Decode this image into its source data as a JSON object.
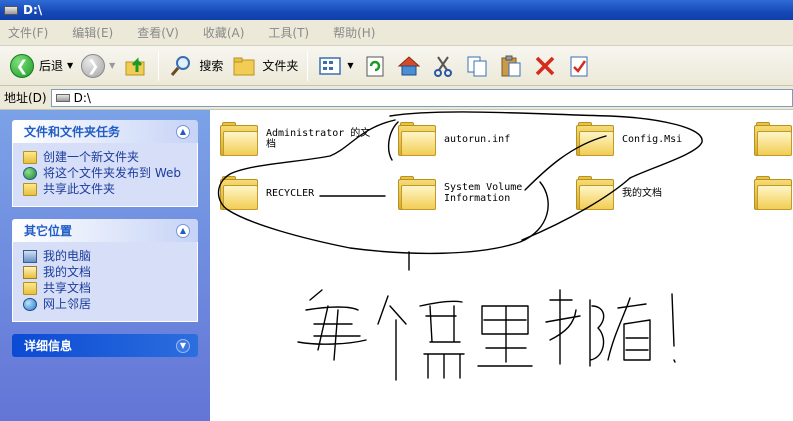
{
  "window": {
    "title": "D:\\"
  },
  "menu": [
    "文件(F)",
    "编辑(E)",
    "查看(V)",
    "收藏(A)",
    "工具(T)",
    "帮助(H)"
  ],
  "toolbar": {
    "back_label": "后退",
    "search_label": "搜索",
    "folders_label": "文件夹"
  },
  "address": {
    "label": "地址(D)",
    "value": "D:\\"
  },
  "task_panels": [
    {
      "title": "文件和文件夹任务",
      "items": [
        {
          "label": "创建一个新文件夹",
          "icon": "new-folder-icon"
        },
        {
          "label": "将这个文件夹发布到 Web",
          "icon": "publish-web-icon"
        },
        {
          "label": "共享此文件夹",
          "icon": "share-folder-icon"
        }
      ]
    },
    {
      "title": "其它位置",
      "items": [
        {
          "label": "我的电脑",
          "icon": "my-computer-icon"
        },
        {
          "label": "我的文档",
          "icon": "my-documents-icon"
        },
        {
          "label": "共享文档",
          "icon": "shared-docs-icon"
        },
        {
          "label": "网上邻居",
          "icon": "network-icon"
        }
      ]
    },
    {
      "title": "详细信息",
      "items": []
    }
  ],
  "files": [
    {
      "name_line1": "Administrator 的文",
      "name_line2": "档"
    },
    {
      "name_line1": "autorun.inf",
      "name_line2": ""
    },
    {
      "name_line1": "Config.Msi",
      "name_line2": ""
    },
    {
      "name_line1": "RECYCLER",
      "name_line2": ""
    },
    {
      "name_line1": "System Volume",
      "name_line2": "Information"
    },
    {
      "name_line1": "我的文档",
      "name_line2": ""
    }
  ],
  "colors": {
    "title_bar": "#1648b8",
    "task_pane": "#6f8fe0",
    "sketch_ink": "#000000"
  }
}
